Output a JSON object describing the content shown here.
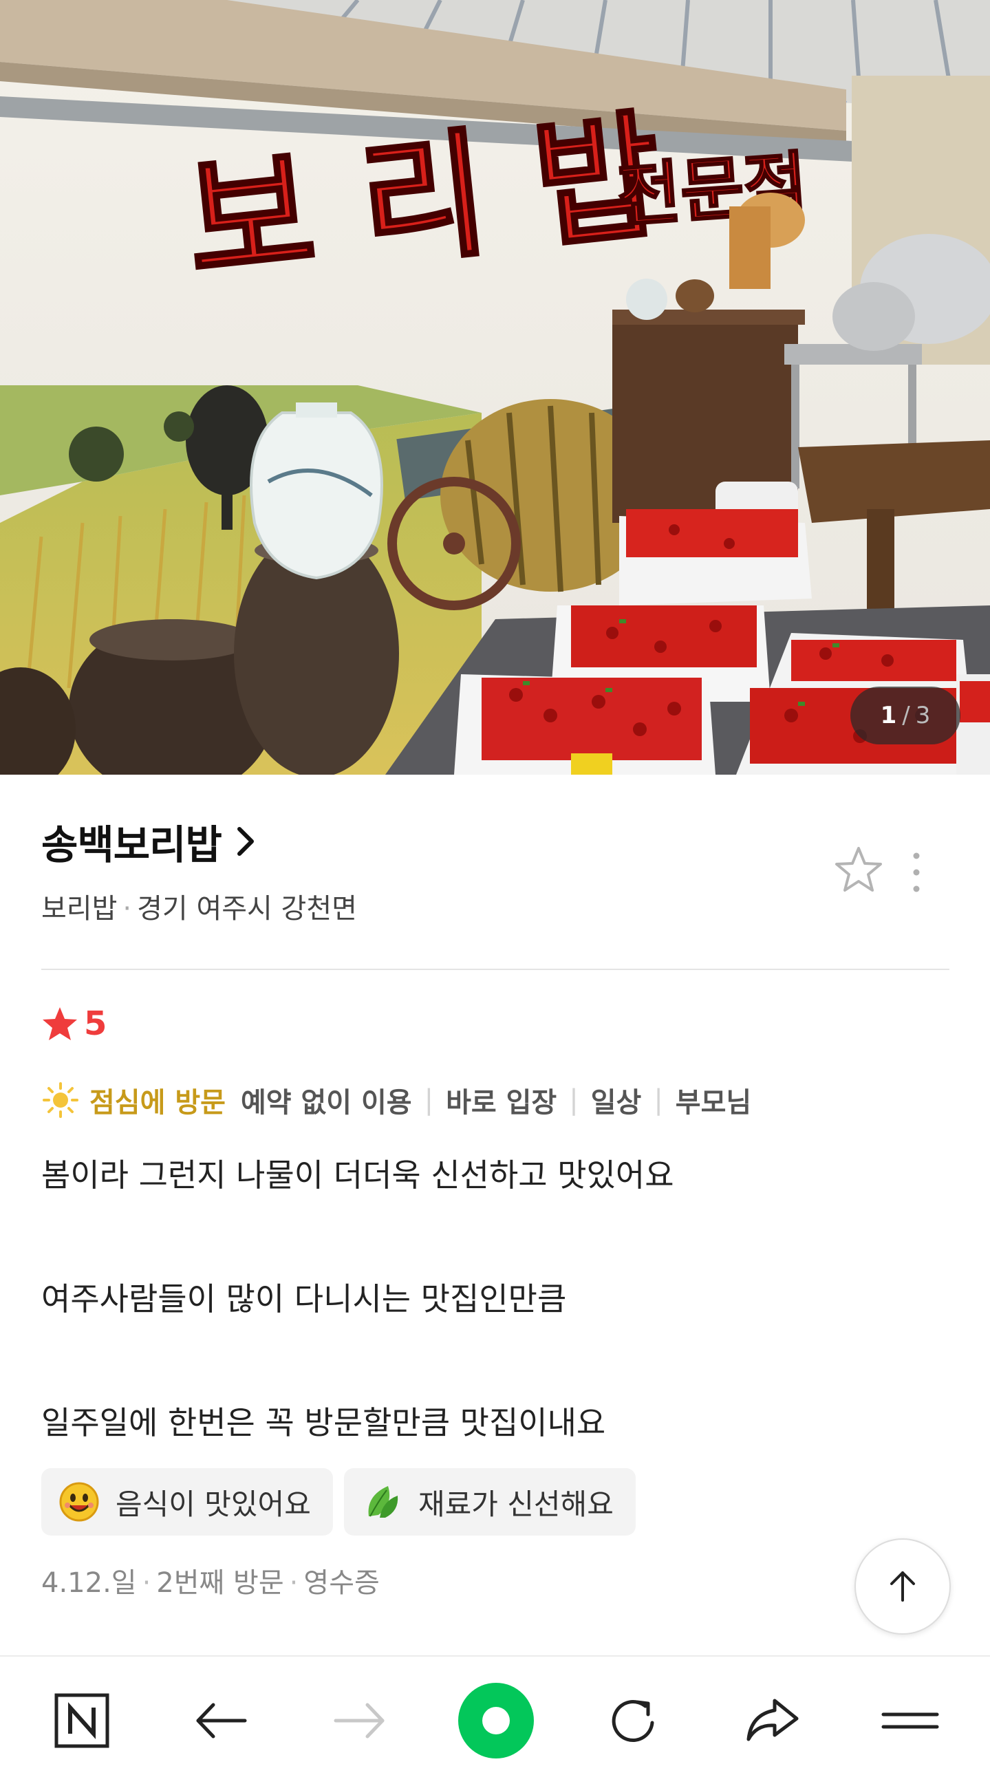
{
  "photo": {
    "sign_text": "보리밥 전문점",
    "counter": {
      "current": "1",
      "separator": "/",
      "total": "3"
    }
  },
  "place": {
    "name": "송백보리밥",
    "category": "보리밥",
    "location": "경기 여주시 강천면"
  },
  "review": {
    "rating": "5",
    "visit_time": "점심에 방문",
    "tags": [
      "예약 없이 이용",
      "바로 입장",
      "일상",
      "부모님"
    ],
    "text_lines": [
      "봄이라 그런지 나물이 더더욱 신선하고 맛있어요",
      "여주사람들이 많이 다니시는 맛집인만큼",
      "일주일에 한번은 꼭 방문할만큼 맛집이내요"
    ],
    "keywords": [
      {
        "label": "음식이 맛있어요",
        "icon": "smiley-face-icon"
      },
      {
        "label": "재료가 신선해요",
        "icon": "leaf-icon"
      }
    ],
    "visit_meta": {
      "date": "4.12.일",
      "visit_count": "2번째 방문",
      "proof": "영수증"
    }
  },
  "bottom_nav": [
    "naver-n-icon",
    "back-arrow-icon",
    "forward-arrow-icon",
    "green-ring-icon",
    "refresh-icon",
    "share-icon",
    "menu-icon"
  ],
  "colors": {
    "rating": "#ef3c3c",
    "visit_time": "#c79a1a",
    "green_button": "#03c75a"
  }
}
